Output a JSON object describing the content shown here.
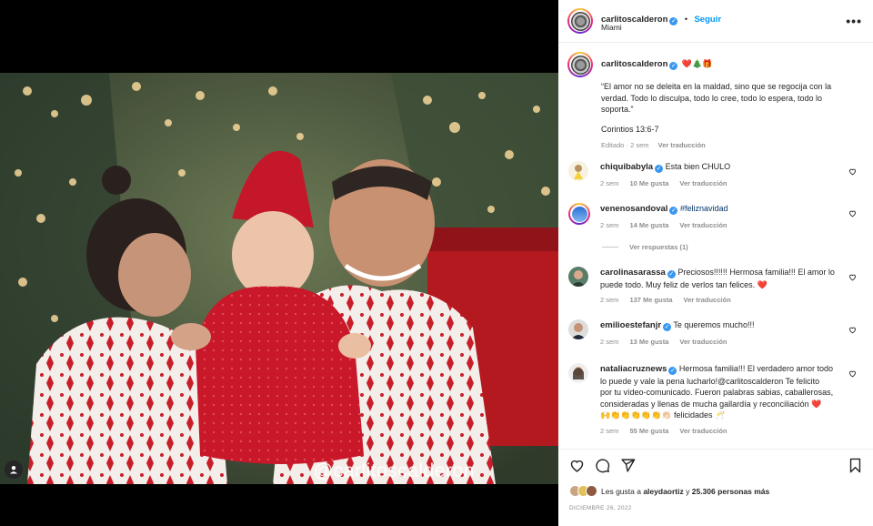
{
  "post": {
    "watermark": "@carlitoscalderon",
    "author": "carlitoscalderon",
    "follow_label": "Seguir",
    "location": "Miami",
    "more_glyph": "•••",
    "caption_emojis": "❤️🎄🎁",
    "caption_lines": [
      "“El amor no se deleita en la maldad, sino que se regocija con la",
      "verdad. Todo lo disculpa, todo lo cree, todo lo espera, todo lo",
      "soporta.”"
    ],
    "caption_ref": "Corintios 13:6-7",
    "caption_meta_edited": "Editado · 2 sem",
    "caption_meta_translate": "Ver traducción"
  },
  "comments": [
    {
      "user": "chiquibabyla",
      "text": "Esta bien CHULO",
      "time": "2 sem",
      "likes": "10 Me gusta",
      "translate": "Ver traducción"
    },
    {
      "user": "venenosandoval",
      "text": "#feliznavidad",
      "time": "2 sem",
      "likes": "14 Me gusta",
      "translate": "Ver traducción",
      "replies": "Ver respuestas (1)"
    },
    {
      "user": "carolinasarassa",
      "text_lines": [
        "Preciosos!!!!!! Hermosa familia!!! El amor lo",
        "puede todo. Muy feliz de verlos tan felices. ❤️"
      ],
      "time": "2 sem",
      "likes": "137 Me gusta",
      "translate": "Ver traducción"
    },
    {
      "user": "emilioestefanjr",
      "text": "Te queremos mucho!!!",
      "time": "2 sem",
      "likes": "13 Me gusta",
      "translate": "Ver traducción"
    },
    {
      "user": "nataliacruznews",
      "text_lines": [
        "Hermosa familia!!! El verdadero amor todo",
        "lo puede y vale la pena lucharlo!@carlitoscalderon Te felicito",
        "por tu vídeo-comunicado. Fueron palabras sabias, caballerosas,",
        "consideradas y llenas de mucha gallardía y reconciliación ❤️",
        "🙌👏👏👏👏👏👏🏻 felicidades 🥂"
      ],
      "time": "2 sem",
      "likes": "55 Me gusta",
      "translate": "Ver traducción"
    }
  ],
  "footer": {
    "likes_prefix": "Les gusta a",
    "likes_user": "aleydaortiz",
    "likes_join": "y",
    "likes_rest": "25.306 personas más",
    "date": "DICIEMBRE 26, 2022"
  },
  "colors": {
    "accent": "#0095f6",
    "verified": "#3897f0",
    "muted": "#8e8e8e",
    "heart": "#ed4956"
  }
}
